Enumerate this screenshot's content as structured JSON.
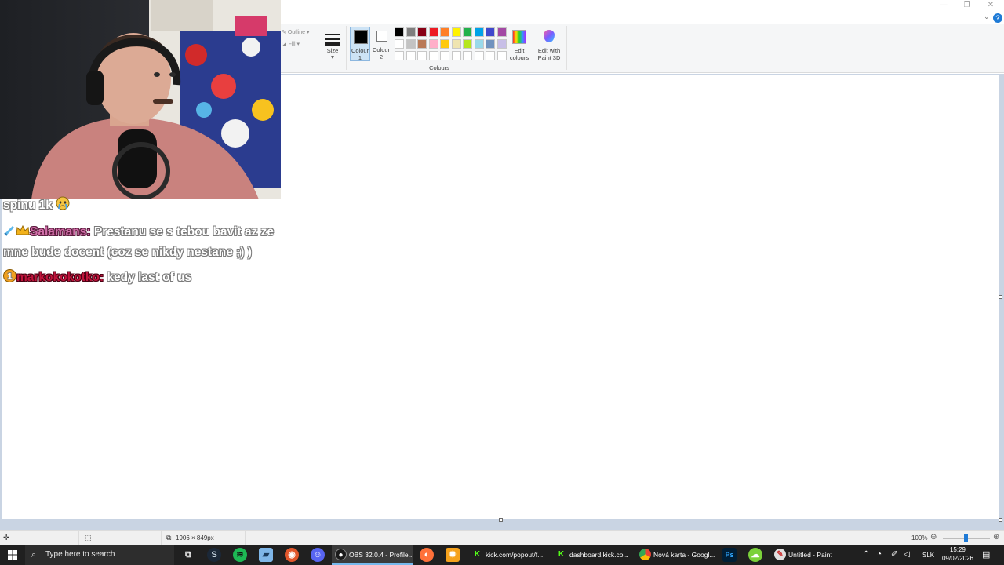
{
  "window": {
    "minimize": "—",
    "maximize": "❐",
    "close": "✕",
    "help": "?"
  },
  "ribbon": {
    "outline_label": "Outline",
    "fill_label": "Fill",
    "size_label": "Size",
    "colour1_label": "Colour 1",
    "colour2_label": "Colour 2",
    "colours_group_label": "Colours",
    "edit_colours_label": "Edit colours",
    "edit_paint3d_label": "Edit with Paint 3D",
    "colour1_value": "#000000",
    "colour2_value": "#ffffff",
    "palette_row1": [
      "#000000",
      "#7f7f7f",
      "#880015",
      "#ed1c24",
      "#ff7f27",
      "#fff200",
      "#22b14c",
      "#00a2e8",
      "#3f48cc",
      "#a349a4"
    ],
    "palette_row2": [
      "#ffffff",
      "#c3c3c3",
      "#b97a57",
      "#ffaec9",
      "#ffc90e",
      "#efe4b0",
      "#b5e61d",
      "#99d9ea",
      "#7092be",
      "#c8bfe7"
    ]
  },
  "chat": {
    "partial_line": "spinu 1k",
    "messages": [
      {
        "badges": [
          "sword-badge",
          "crown-badge"
        ],
        "user": "Salamans:",
        "text": "Prestanu se s tebou bavit az ze mne bude docent (coz se nikdy nestane ;) )"
      },
      {
        "badges": [
          "sub-badge"
        ],
        "user": "markokokotko:",
        "text": "kedy last of us"
      }
    ]
  },
  "statusbar": {
    "dimensions": "1906 × 849px",
    "zoom": "100%",
    "zoom_fraction": 0.5
  },
  "taskbar": {
    "search_placeholder": "Type here to search",
    "apps": [
      {
        "label": "OBS 32.0.4 - Profile...",
        "icon": "obs-icon",
        "active": true
      },
      {
        "label": "kick.com/popout/f...",
        "icon": "kick-icon",
        "active": false
      },
      {
        "label": "dashboard.kick.co...",
        "icon": "kick-icon",
        "active": false
      },
      {
        "label": "Nová karta - Googl...",
        "icon": "chrome-icon",
        "active": false
      },
      {
        "label": "Untitled - Paint",
        "icon": "paint-icon",
        "active": false
      }
    ],
    "language": "SLK",
    "time": "15:29",
    "date": "09/02/2026"
  },
  "colors": {
    "canvas_bg": "#c9d4e3",
    "taskbar_bg": "#202020",
    "accent": "#1e7ad6"
  }
}
